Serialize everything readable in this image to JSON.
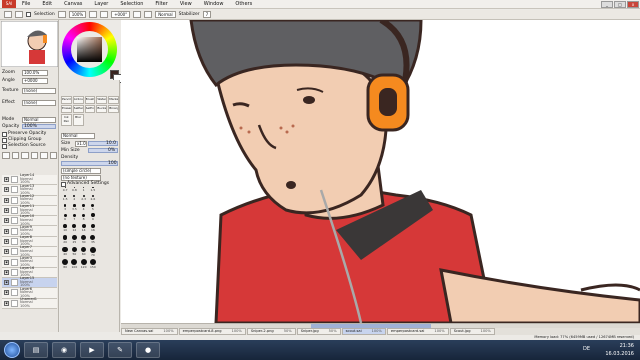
{
  "app": {
    "logo": "SAI",
    "title_buttons": [
      "_",
      "□",
      "x"
    ]
  },
  "menu": [
    "File",
    "Edit",
    "Canvas",
    "Layer",
    "Selection",
    "Filter",
    "View",
    "Window",
    "Others"
  ],
  "toolbar": {
    "selection_label": "Selection",
    "zoom": "100%",
    "angle": "+000°",
    "mode": "Normal",
    "stabilizer_label": "Stabilizer",
    "stabilizer": "7"
  },
  "navigator": {
    "zoom_label": "Zoom",
    "zoom": "100.0%",
    "angle_label": "Angle",
    "angle": "+0000"
  },
  "layer_props": {
    "texture_label": "Texture",
    "texture": "(none)",
    "effect_label": "Effect",
    "effect": "(none)",
    "mode_label": "Mode",
    "mode": "Normal",
    "opacity_label": "Opacity",
    "opacity": "100%",
    "preserve_opacity": "Preserve Opacity",
    "clipping_group": "Clipping Group",
    "selection_source": "Selection Source"
  },
  "tools": [
    "Pencil",
    "Airbrush",
    "Brush",
    "Water",
    "Marker",
    "Eraser",
    "SelPen",
    "SelErase",
    "Bucket",
    "Binary",
    "Ink Pen",
    "Blur"
  ],
  "brush": {
    "blend_mode": "Normal",
    "size_label": "Size",
    "size_mult": "x1.0",
    "size": "10.0",
    "min_size_label": "Min Size",
    "min_size": "0%",
    "density_label": "Density",
    "density": "100",
    "shape": "(simple circle)",
    "texture": "(no texture)",
    "advanced": "Advanced Settings"
  },
  "brush_sizes": [
    "0.7",
    "0.8",
    "1",
    "1.5",
    "1.5",
    "2",
    "2.3",
    "2.6",
    "3",
    "3.5",
    "4",
    "5",
    "6",
    "7",
    "8",
    "9",
    "10",
    "12",
    "14",
    "16",
    "20",
    "25",
    "30",
    "35",
    "40",
    "50",
    "60",
    "70",
    "80",
    "100",
    "120",
    "150"
  ],
  "layers": [
    {
      "name": "Layer14",
      "mode": "Normal",
      "opacity": "100%"
    },
    {
      "name": "Layer13",
      "mode": "Normal",
      "opacity": "100%"
    },
    {
      "name": "Layer12",
      "mode": "Normal",
      "opacity": "100%"
    },
    {
      "name": "Layer11",
      "mode": "Normal",
      "opacity": "100%"
    },
    {
      "name": "Layer10",
      "mode": "Normal",
      "opacity": "100%"
    },
    {
      "name": "Layer9",
      "mode": "Normal",
      "opacity": "100%"
    },
    {
      "name": "Layer8",
      "mode": "Normal",
      "opacity": "100%"
    },
    {
      "name": "Layer7",
      "mode": "Normal",
      "opacity": "100%"
    },
    {
      "name": "Layer3",
      "mode": "Normal",
      "opacity": "100%"
    },
    {
      "name": "Layer16",
      "mode": "Normal",
      "opacity": "100%"
    },
    {
      "name": "Layer15",
      "mode": "Normal",
      "opacity": "100%"
    },
    {
      "name": "Layer6",
      "mode": "Normal",
      "opacity": "100%"
    },
    {
      "name": "Unamed1",
      "mode": "Normal",
      "opacity": "100%"
    }
  ],
  "tabs": [
    {
      "name": "New Canvas.sai",
      "pct": "100%"
    },
    {
      "name": "emperpostcard-8.png",
      "pct": "100%"
    },
    {
      "name": "Sniper-2.png",
      "pct": "50%"
    },
    {
      "name": "Sniper.jpg",
      "pct": "50%"
    },
    {
      "name": "scout.sai",
      "pct": "100%"
    },
    {
      "name": "emperpostcard.sai",
      "pct": "100%"
    },
    {
      "name": "Scout.jpg",
      "pct": "100%"
    }
  ],
  "status": "Memory load: 77% (6459MB used / 12674MB reserved)",
  "tray": {
    "lang": "DE",
    "time": "21:36",
    "date": "16.03.2016"
  },
  "colors": {
    "cap": "#5f5f62",
    "skin": "#f2cdb2",
    "shirt": "#d63838",
    "outline": "#3a2621",
    "headphone": "#f58a1f",
    "strap": "#3a3737",
    "accent": "#9fb1d6"
  }
}
